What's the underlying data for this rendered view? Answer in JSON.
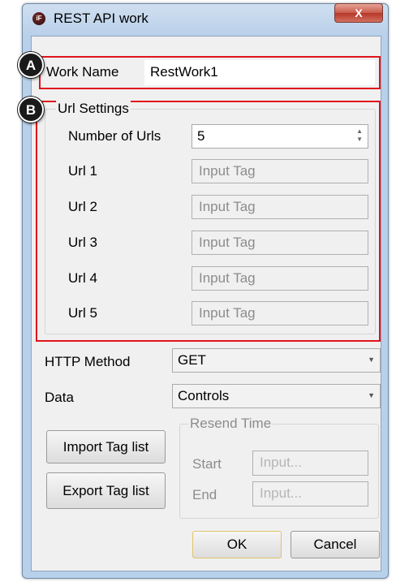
{
  "window": {
    "title": "REST API work",
    "close_label": "X",
    "icon_label": "iF"
  },
  "work_name": {
    "label": "Work Name",
    "value": "RestWork1"
  },
  "url_settings": {
    "legend": "Url Settings",
    "number_label": "Number of Urls",
    "number_value": "5",
    "urls": [
      {
        "label": "Url 1",
        "placeholder": "Input Tag"
      },
      {
        "label": "Url 2",
        "placeholder": "Input Tag"
      },
      {
        "label": "Url 3",
        "placeholder": "Input Tag"
      },
      {
        "label": "Url 4",
        "placeholder": "Input Tag"
      },
      {
        "label": "Url 5",
        "placeholder": "Input Tag"
      }
    ]
  },
  "http_method": {
    "label": "HTTP Method",
    "value": "GET"
  },
  "data_field": {
    "label": "Data",
    "value": "Controls"
  },
  "buttons": {
    "import": "Import Tag list",
    "export": "Export Tag list",
    "ok": "OK",
    "cancel": "Cancel"
  },
  "resend_time": {
    "legend": "Resend Time",
    "start_label": "Start",
    "start_placeholder": "Input...",
    "end_label": "End",
    "end_placeholder": "Input..."
  },
  "annotations": {
    "a": "A",
    "b": "B"
  },
  "colors": {
    "highlight": "#e0141c",
    "badge": "#1a1a1a"
  }
}
